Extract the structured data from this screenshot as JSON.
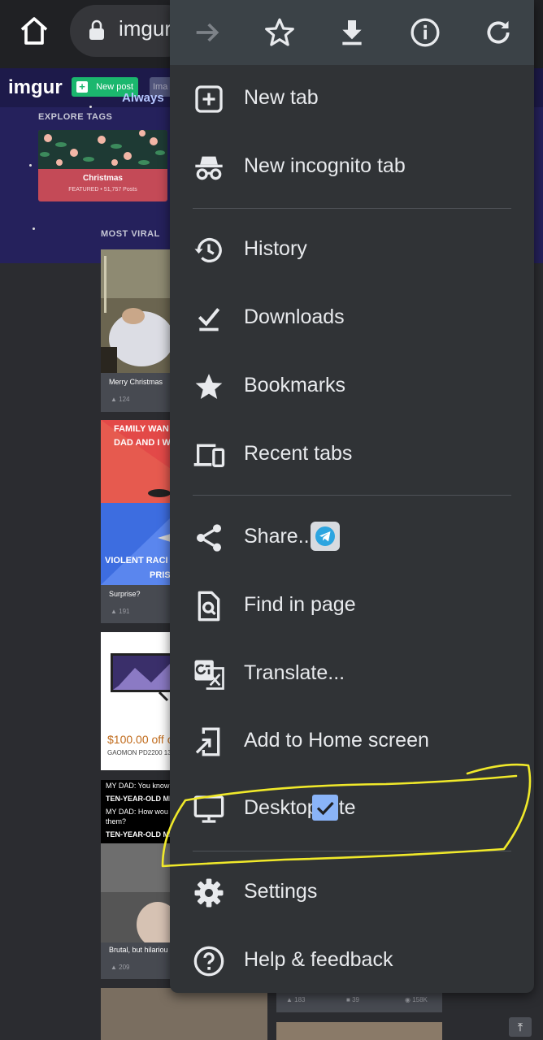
{
  "browser": {
    "url_text": "imgur",
    "toolbar_icons": [
      "forward-arrow-icon",
      "star-icon",
      "download-icon",
      "info-icon",
      "reload-icon"
    ]
  },
  "page": {
    "logo": "imgur",
    "new_post_label": "New post",
    "tab_stub": "Ima",
    "tagline": "Always",
    "explore_tags_label": "EXPLORE TAGS",
    "tag": {
      "name": "Christmas",
      "meta": "FEATURED • 51,757 Posts"
    },
    "most_viral_label": "MOST VIRAL",
    "cards": [
      {
        "title": "Merry Christmas",
        "votes": "124"
      },
      {
        "title": "Surprise?",
        "votes": "191",
        "meme_top": "FAMILY WAN",
        "meme_top2": "DAD AND I W",
        "meme_bottom": "VIOLENT RACI",
        "meme_bottom2": "PRIS"
      },
      {
        "title": "GAOMON PD2200 13",
        "price": "$100.00 off c"
      },
      {
        "title": "Brutal, but hilariou",
        "votes": "209",
        "lines": [
          "MY DAD: You know",
          "TEN-YEAR-OLD MI",
          "MY DAD: How wou",
          "them?",
          "TEN-YEAR-OLD MI"
        ]
      }
    ],
    "bottom_stats": {
      "ups": "183",
      "comments": "39",
      "views": "158K"
    }
  },
  "menu": {
    "items": [
      {
        "label": "New tab",
        "icon": "new-tab-icon"
      },
      {
        "label": "New incognito tab",
        "icon": "incognito-icon"
      },
      {
        "label": "History",
        "icon": "history-icon"
      },
      {
        "label": "Downloads",
        "icon": "downloads-icon"
      },
      {
        "label": "Bookmarks",
        "icon": "bookmarks-icon"
      },
      {
        "label": "Recent tabs",
        "icon": "recent-tabs-icon"
      },
      {
        "label": "Share...",
        "icon": "share-icon"
      },
      {
        "label": "Find in page",
        "icon": "find-in-page-icon"
      },
      {
        "label": "Translate...",
        "icon": "translate-icon"
      },
      {
        "label": "Add to Home screen",
        "icon": "add-to-home-icon"
      },
      {
        "label": "Desktop site",
        "icon": "desktop-icon",
        "checked": true
      },
      {
        "label": "Settings",
        "icon": "settings-icon"
      },
      {
        "label": "Help & feedback",
        "icon": "help-icon"
      }
    ]
  },
  "colors": {
    "menu_bg": "#303336",
    "menu_top_bg": "#3b4247",
    "accent": "#8ab4f8",
    "highlight": "#f0e92a"
  }
}
